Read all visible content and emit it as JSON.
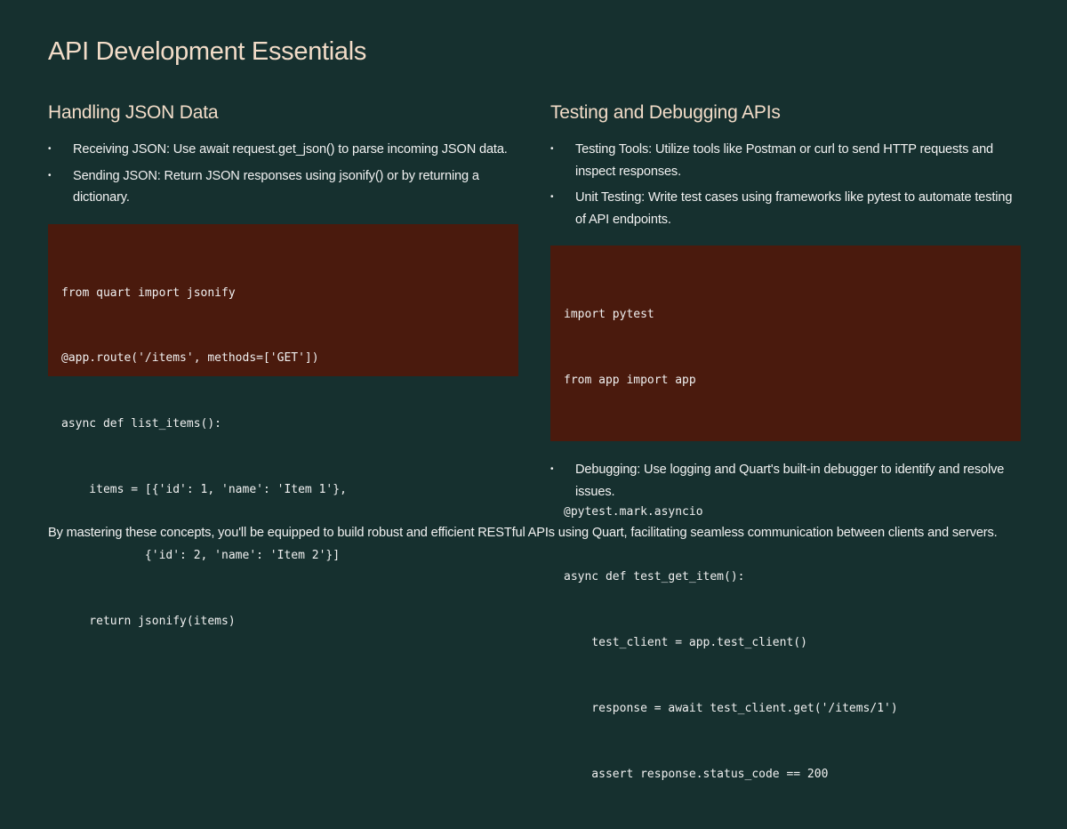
{
  "slide": {
    "title": "API Development Essentials",
    "left": {
      "heading": "Handling JSON Data",
      "bullets": [
        "Receiving JSON: Use await request.get_json() to parse incoming JSON data.",
        "Sending JSON: Return JSON responses using jsonify() or by returning a dictionary."
      ],
      "code": [
        "from quart import jsonify",
        "@app.route('/items', methods=['GET'])",
        "async def list_items():",
        "    items = [{'id': 1, 'name': 'Item 1'},",
        "            {'id': 2, 'name': 'Item 2'}]",
        "    return jsonify(items)"
      ]
    },
    "right": {
      "heading": "Testing and Debugging APIs",
      "bullets": [
        "Testing Tools: Utilize tools like Postman or curl to send HTTP requests and inspect responses.",
        "Unit Testing: Write test cases using frameworks like pytest to automate testing of API endpoints."
      ],
      "code": [
        "import pytest",
        "from app import app",
        "",
        "@pytest.mark.asyncio",
        "async def test_get_item():",
        "    test_client = app.test_client()",
        "    response = await test_client.get('/items/1')",
        "    assert response.status_code == 200"
      ],
      "after_bullets": [
        "Debugging: Use logging and Quart's built-in debugger to identify and resolve issues."
      ]
    },
    "footer": "By mastering these concepts, you'll be equipped to build robust and efficient RESTful APIs using Quart, facilitating seamless communication between clients and servers.",
    "bullet_glyph": "•",
    "colors": {
      "background": "#16302f",
      "heading": "#f2dcc8",
      "code_background": "#4a1a0d",
      "text": "#f2f2f2"
    }
  }
}
